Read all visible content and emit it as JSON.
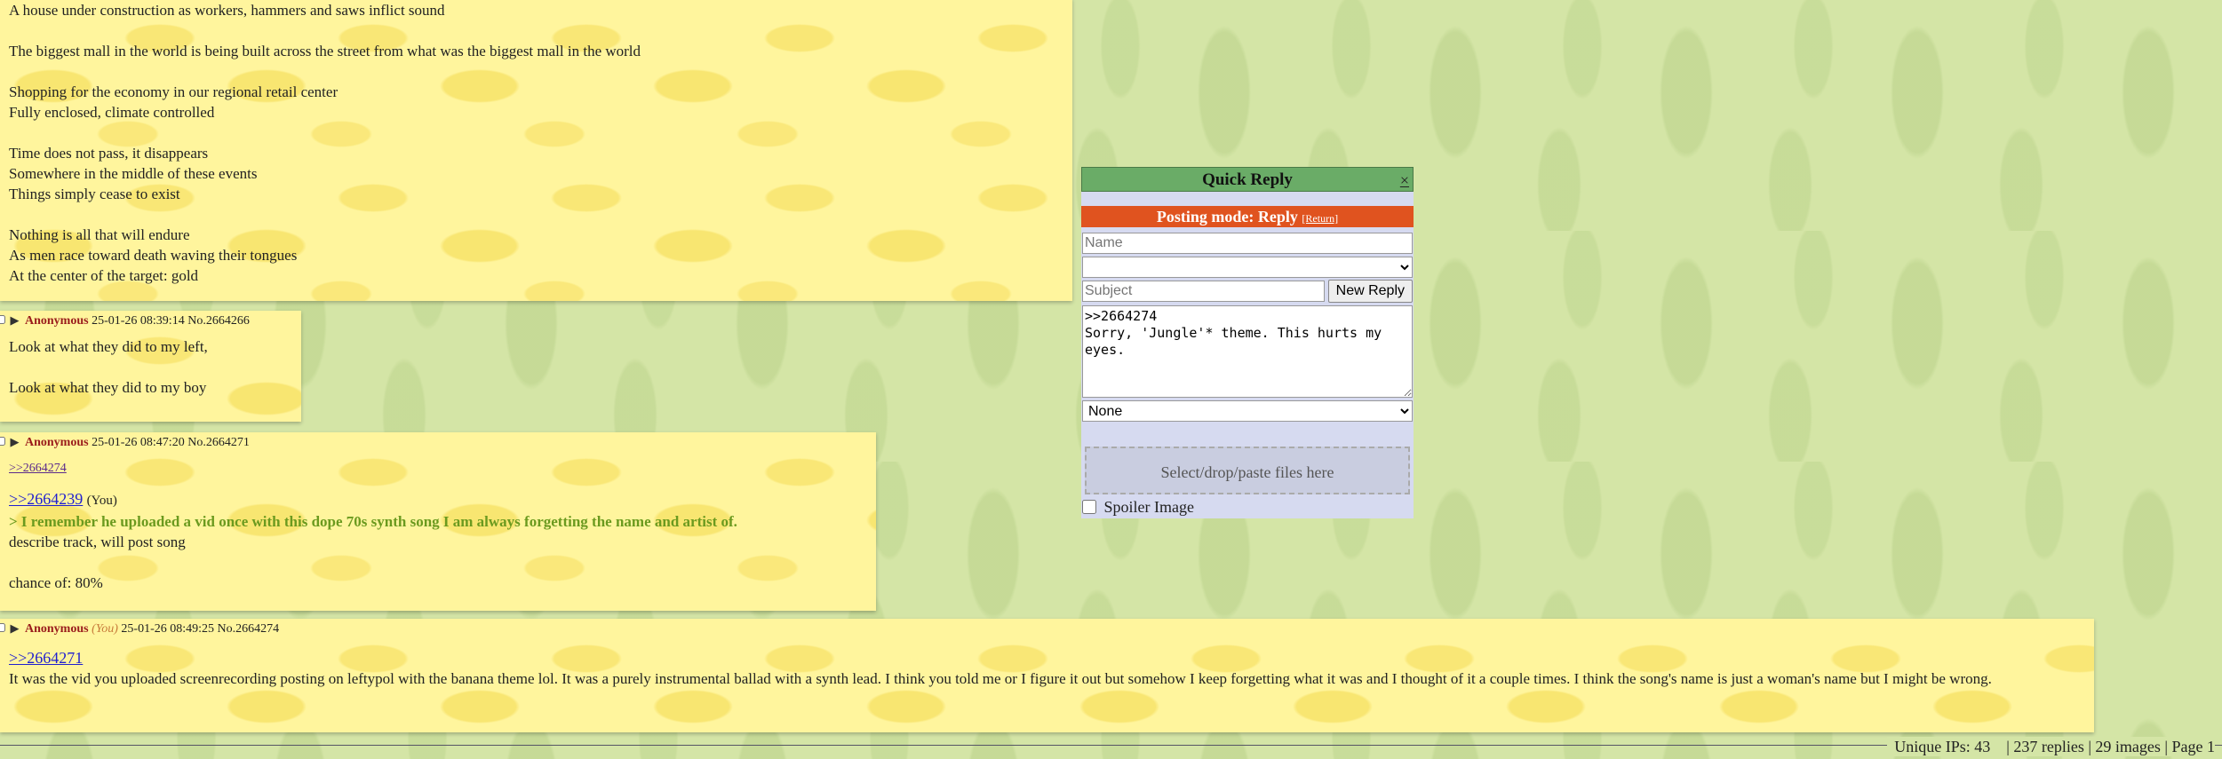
{
  "post1": {
    "lines": [
      "A house under construction as workers, hammers and saws inflict sound",
      "",
      "The biggest mall in the world is being built across the street from what was the biggest mall in the world",
      "",
      "Shopping for the economy in our regional retail center",
      "Fully enclosed, climate controlled",
      "",
      "Time does not pass, it disappears",
      "Somewhere in the middle of these events",
      "Things simply cease to exist",
      "",
      "Nothing is all that will endure",
      "As men race toward death waving their tongues",
      "At the center of the target: gold"
    ]
  },
  "post2": {
    "name": "Anonymous",
    "datetime": "25-01-26 08:39:14",
    "number": "No.2664266",
    "line1": "Look at what they did to my left,",
    "line2": "Look at what they did to my boy"
  },
  "post3": {
    "name": "Anonymous",
    "datetime": "25-01-26 08:47:20",
    "number": "No.2664271",
    "backlink": ">>2664274",
    "quote": ">>2664239",
    "quote_you": "(You)",
    "greentext": "> I remember he uploaded a vid once with this dope 70s synth song I am always forgetting the name and artist of.",
    "line1": "describe track, will post song",
    "line2": "chance of: 80%"
  },
  "post4": {
    "name": "Anonymous",
    "you": "(You)",
    "datetime": "25-01-26 08:49:25",
    "number": "No.2664274",
    "quote": ">>2664271",
    "text": "It was the vid you uploaded screenrecording posting on leftypol with the banana theme lol. It was a purely instrumental ballad with a synth lead. I think you told me or I figure it out but somehow I keep forgetting what it was and I thought of it a couple times. I think the song's name is just a woman's name but I might be wrong."
  },
  "quick_reply": {
    "title": "Quick Reply",
    "close": "×",
    "mode": "Posting mode: Reply",
    "return": "[Return]",
    "name_placeholder": "Name",
    "subject_placeholder": "Subject",
    "new_reply": "New Reply",
    "message": ">>2664274\nSorry, 'Jungle'* theme. This hurts my eyes.",
    "flag_select": "None",
    "drop_text": "Select/drop/paste files here",
    "spoiler": "Spoiler Image"
  },
  "footer": {
    "stats": "Unique IPs: 43    | 237 replies | 29 images | Page 1"
  },
  "colors": {
    "page_bg": "#d4e5a6",
    "post_bg": "#fff59d",
    "qr_title": "#6aac67",
    "mode_bar": "#e0531f",
    "name": "#9a1c1c",
    "greentext": "#6b9a1f"
  }
}
